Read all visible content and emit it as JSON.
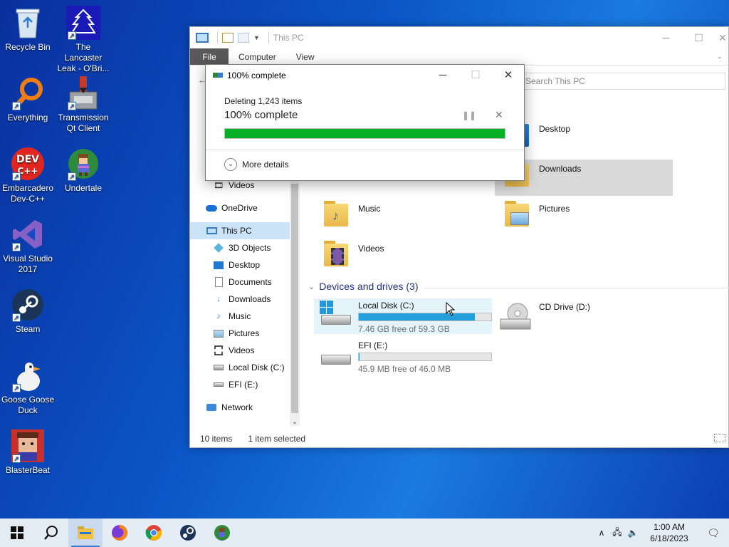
{
  "desktop": {
    "icons": [
      {
        "label": "Recycle Bin",
        "icon": "recycle-bin-icon"
      },
      {
        "label": "The Lancaster Leak - O'Bri...",
        "icon": "shortcut-document-icon"
      },
      {
        "label": "Everything",
        "icon": "everything-search-icon"
      },
      {
        "label": "Transmission Qt Client",
        "icon": "transmission-icon"
      },
      {
        "label": "Embarcadero Dev-C++",
        "icon": "devcpp-icon"
      },
      {
        "label": "Undertale",
        "icon": "undertale-icon"
      },
      {
        "label": "Visual Studio 2017",
        "icon": "visual-studio-icon"
      },
      {
        "label": "Steam",
        "icon": "steam-icon"
      },
      {
        "label": "Goose Goose Duck",
        "icon": "goose-goose-duck-icon"
      },
      {
        "label": "BlasterBeat",
        "icon": "blasterbeat-icon"
      }
    ]
  },
  "explorer": {
    "title": "This PC",
    "ribbon_tabs": [
      "File",
      "Computer",
      "View"
    ],
    "search_placeholder": "Search This PC",
    "nav": {
      "partial_top": "Videos",
      "onedrive": "OneDrive",
      "this_pc": "This PC",
      "items": [
        "3D Objects",
        "Desktop",
        "Documents",
        "Downloads",
        "Music",
        "Pictures",
        "Videos",
        "Local Disk (C:)",
        "EFI (E:)"
      ],
      "network": "Network"
    },
    "folders": {
      "desktop": "Desktop",
      "downloads": "Downloads",
      "music": "Music",
      "pictures": "Pictures",
      "videos": "Videos"
    },
    "devices_header": "Devices and drives (3)",
    "drives": [
      {
        "name": "Local Disk (C:)",
        "free": "7.46 GB free of 59.3 GB",
        "used_fraction": 0.874
      },
      {
        "name": "CD Drive (D:)"
      },
      {
        "name": "EFI (E:)",
        "free": "45.9 MB free of 46.0 MB",
        "used_fraction": 0.002
      }
    ],
    "status": {
      "items": "10 items",
      "selected": "1 item selected"
    }
  },
  "dialog": {
    "title": "100% complete",
    "subtitle": "Deleting 1,243 items",
    "percent_text": "100% complete",
    "progress_fraction": 1.0,
    "more_details": "More details",
    "progress_color": "#06b025"
  },
  "taskbar": {
    "apps": [
      "start-icon",
      "search-icon",
      "file-explorer-icon",
      "firefox-icon",
      "chrome-icon",
      "steam-icon",
      "undertale-icon"
    ],
    "time": "1:00 AM",
    "date": "6/18/2023"
  }
}
